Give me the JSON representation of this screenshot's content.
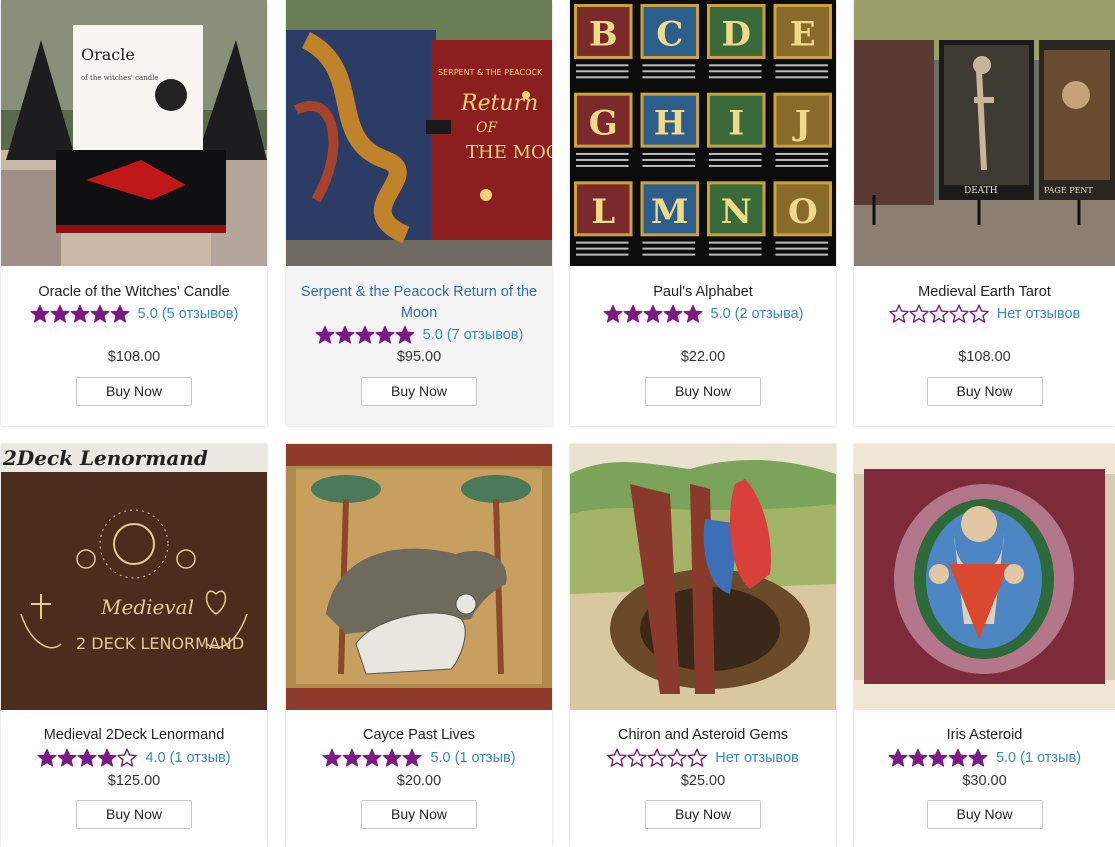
{
  "accent_color": "#7b1a86",
  "link_color": "#3a87c6",
  "products": [
    {
      "title": "Oracle of the Witches' Candle",
      "rating_stars": 5,
      "rating_text": "5.0 (5 отзывов)",
      "price": "$108.00",
      "button": "Buy Now",
      "image_text_1": "Oracle",
      "image_text_2": "of the witches' candle"
    },
    {
      "title": "Serpent & the Peacock Return of the Moon",
      "rating_stars": 5,
      "rating_text": "5.0 (7 отзывов)",
      "price": "$95.00",
      "button": "Buy Now",
      "image_text_1": "SERPENT & THE PEACOCK",
      "image_text_2": "Return",
      "image_text_3": "OF",
      "image_text_4": "THE MOON"
    },
    {
      "title": "Paul's Alphabet",
      "rating_stars": 5,
      "rating_text": "5.0 (2 отзыва)",
      "price": "$22.00",
      "button": "Buy Now",
      "letters": [
        "B",
        "C",
        "D",
        "E",
        "G",
        "H",
        "I",
        "J",
        "L",
        "M",
        "N",
        "O"
      ]
    },
    {
      "title": "Medieval Earth Tarot",
      "rating_stars": 0,
      "rating_text": "Нет отзывов",
      "price": "$108.00",
      "button": "Buy Now",
      "image_text_1": "DEATH",
      "image_text_2": "PAGE PENT"
    },
    {
      "title": "Medieval 2Deck Lenormand",
      "rating_stars": 4,
      "rating_text": "4.0 (1 отзыв)",
      "price": "$125.00",
      "button": "Buy Now",
      "image_text_1": "2Deck Lenormand",
      "image_text_2": "Medieval",
      "image_text_3": "2 DECK LENORMAND"
    },
    {
      "title": "Cayce Past Lives",
      "rating_stars": 5,
      "rating_text": "5.0 (1 отзыв)",
      "price": "$20.00",
      "button": "Buy Now"
    },
    {
      "title": "Chiron and Asteroid Gems",
      "rating_stars": 0,
      "rating_text": "Нет отзывов",
      "price": "$25.00",
      "button": "Buy Now"
    },
    {
      "title": "Iris Asteroid",
      "rating_stars": 5,
      "rating_text": "5.0 (1 отзыв)",
      "price": "$30.00",
      "button": "Buy Now"
    }
  ]
}
